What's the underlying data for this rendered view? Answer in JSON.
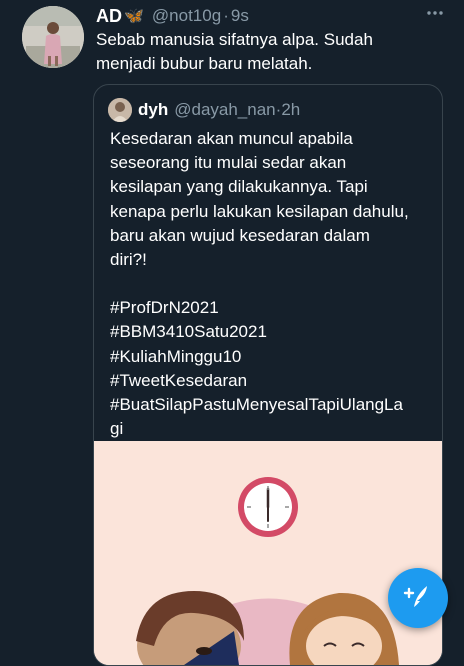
{
  "tweet": {
    "author_name": "AD",
    "author_badge": "🦋",
    "handle": "@not10g",
    "separator": "·",
    "time": "9s",
    "lines": [
      "Sebab manusia sifatnya alpa. Sudah",
      "menjadi bubur baru melatah."
    ]
  },
  "quoted_tweet": {
    "author_name": "dyh",
    "handle": "@dayah_nan",
    "separator": "·",
    "time": "2h",
    "lines": [
      "Kesedaran akan muncul apabila",
      "seseorang itu mulai sedar akan",
      "kesilapan yang dilakukannya. Tapi",
      "kenapa perlu lakukan kesilapan dahulu,",
      "baru akan wujud kesedaran dalam",
      "diri?!",
      "",
      "#ProfDrN2021",
      "#BBM3410Satu2021",
      "#KuliahMinggu10",
      "#TweetKesedaran",
      "#BuatSilapPastuMenyesalTapiUlangLa",
      "gi"
    ]
  },
  "icons": {
    "more": "more-horizontal-icon",
    "compose": "compose-tweet-icon"
  },
  "colors": {
    "background": "#15202b",
    "accent": "#1d9bf0",
    "secondary_text": "#8899a6",
    "border": "#38444d"
  }
}
